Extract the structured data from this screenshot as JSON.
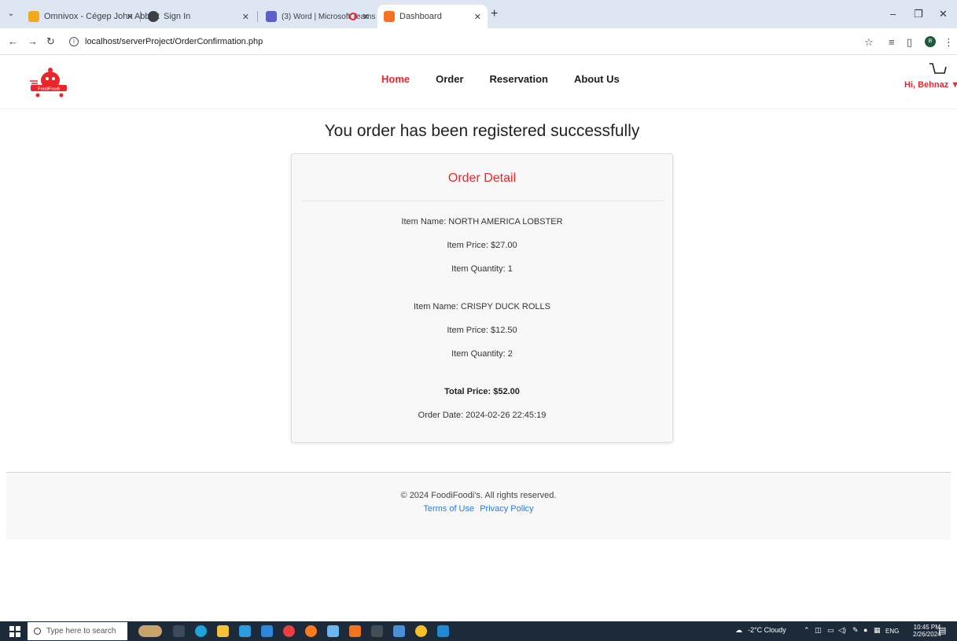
{
  "browser": {
    "tabs": [
      {
        "label": "Omnivox - Cégep John Abbott"
      },
      {
        "label": "Sign In"
      },
      {
        "label": "(3) Word | Microsoft Teams"
      },
      {
        "label": "Dashboard"
      }
    ],
    "url": "localhost/serverProject/OrderConfirmation.php",
    "profile_initial": "B"
  },
  "header": {
    "logo_text": "FoodiFoodi",
    "nav": [
      {
        "label": "Home",
        "active": true
      },
      {
        "label": "Order"
      },
      {
        "label": "Reservation"
      },
      {
        "label": "About Us"
      }
    ],
    "greeting": "Hi, Behnaz ▼"
  },
  "main": {
    "headline": "You order has been registered successfully",
    "card_title": "Order Detail",
    "items": [
      {
        "name": "Item Name: NORTH AMERICA LOBSTER",
        "price": "Item Price: $27.00",
        "quantity": "Item Quantity: 1"
      },
      {
        "name": "Item Name: CRISPY DUCK ROLLS",
        "price": "Item Price: $12.50",
        "quantity": "Item Quantity: 2"
      }
    ],
    "total": "Total Price: $52.00",
    "order_date": "Order Date: 2024-02-26 22:45:19"
  },
  "footer": {
    "copyright": "© 2024 FoodiFoodi's. All rights reserved.",
    "terms": "Terms of Use",
    "privacy": "Privacy Policy"
  },
  "taskbar": {
    "search_placeholder": "Type here to search",
    "weather": "-2°C Cloudy",
    "lang": "ENG",
    "time": "10:45 PM",
    "date": "2/26/2024"
  },
  "colors": {
    "accent": "#e8262c",
    "link": "#2a7ae2",
    "taskbar": "#1c2a3a"
  }
}
